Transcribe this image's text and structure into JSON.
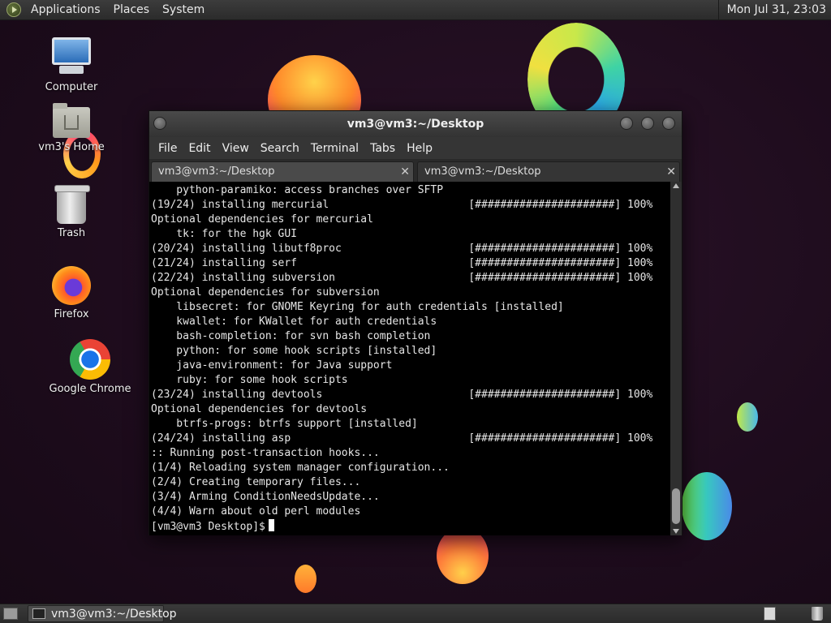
{
  "top_panel": {
    "menu": [
      "Applications",
      "Places",
      "System"
    ],
    "clock": "Mon Jul 31, 23:03"
  },
  "desktop_icons": [
    {
      "label": "Computer",
      "icon": "computer-icon"
    },
    {
      "label": "vm3's Home",
      "icon": "home-folder-icon"
    },
    {
      "label": "Trash",
      "icon": "trash-icon"
    },
    {
      "label": "Firefox",
      "icon": "firefox-icon"
    },
    {
      "label": "Google Chrome",
      "icon": "chrome-icon"
    }
  ],
  "terminal": {
    "title": "vm3@vm3:~/Desktop",
    "menu": [
      "File",
      "Edit",
      "View",
      "Search",
      "Terminal",
      "Tabs",
      "Help"
    ],
    "tabs": [
      {
        "label": "vm3@vm3:~/Desktop",
        "active": true
      },
      {
        "label": "vm3@vm3:~/Desktop",
        "active": false
      }
    ],
    "lines": [
      "    python-paramiko: access branches over SFTP",
      "(19/24) installing mercurial                      [######################] 100%",
      "Optional dependencies for mercurial",
      "    tk: for the hgk GUI",
      "(20/24) installing libutf8proc                    [######################] 100%",
      "(21/24) installing serf                           [######################] 100%",
      "(22/24) installing subversion                     [######################] 100%",
      "Optional dependencies for subversion",
      "    libsecret: for GNOME Keyring for auth credentials [installed]",
      "    kwallet: for KWallet for auth credentials",
      "    bash-completion: for svn bash completion",
      "    python: for some hook scripts [installed]",
      "    java-environment: for Java support",
      "    ruby: for some hook scripts",
      "(23/24) installing devtools                       [######################] 100%",
      "Optional dependencies for devtools",
      "    btrfs-progs: btrfs support [installed]",
      "(24/24) installing asp                            [######################] 100%",
      ":: Running post-transaction hooks...",
      "(1/4) Reloading system manager configuration...",
      "(2/4) Creating temporary files...",
      "(3/4) Arming ConditionNeedsUpdate...",
      "(4/4) Warn about old perl modules"
    ],
    "prompt": "[vm3@vm3 Desktop]$"
  },
  "taskbar": {
    "window_button": "vm3@vm3:~/Desktop"
  },
  "colors": {
    "desktop_bg": "#1e0c1d",
    "panel_bg": "#2b2b2b",
    "terminal_bg": "#000000",
    "terminal_fg": "#e6e6e6"
  }
}
